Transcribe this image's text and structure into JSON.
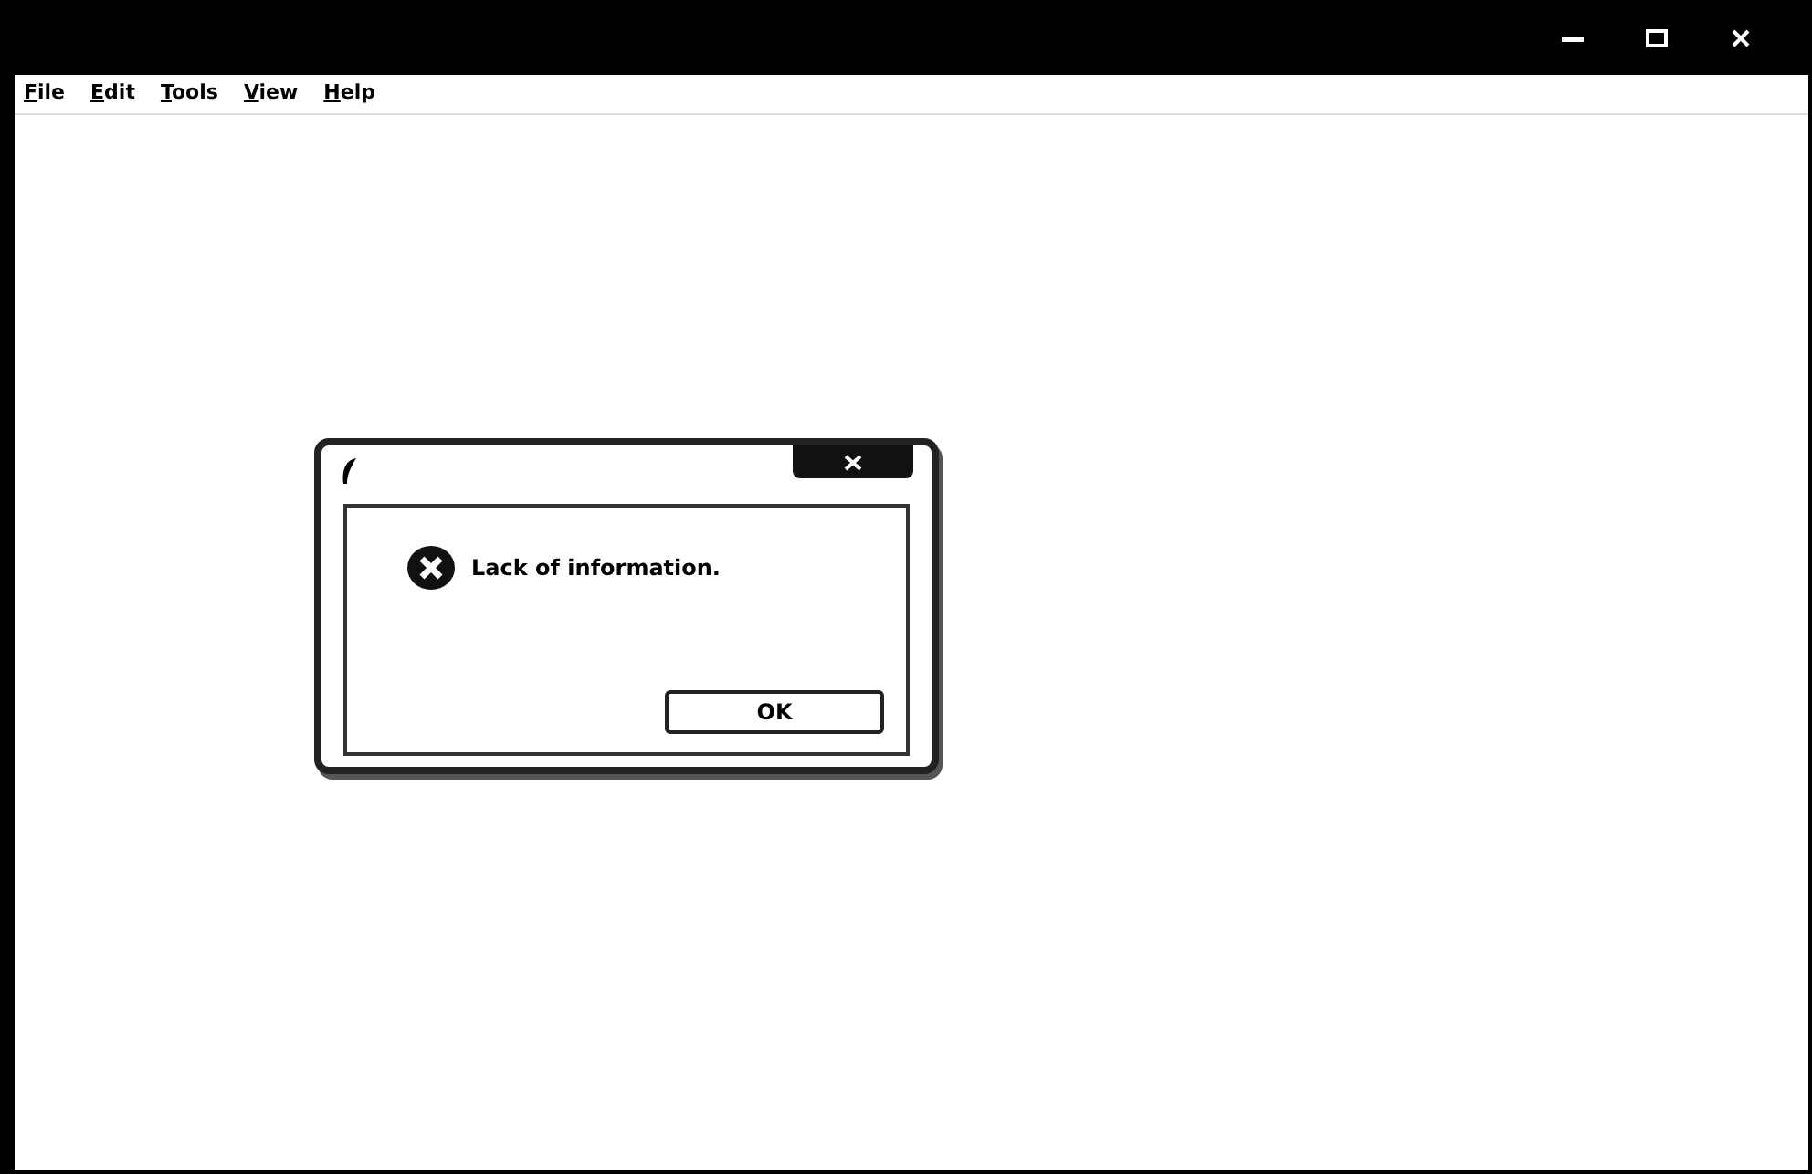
{
  "menu": [
    {
      "label": "File"
    },
    {
      "label": "Edit"
    },
    {
      "label": "Tools"
    },
    {
      "label": "View"
    },
    {
      "label": "Help"
    }
  ],
  "dialog": {
    "message": "Lack of information.",
    "buttons": [
      "OK"
    ]
  }
}
